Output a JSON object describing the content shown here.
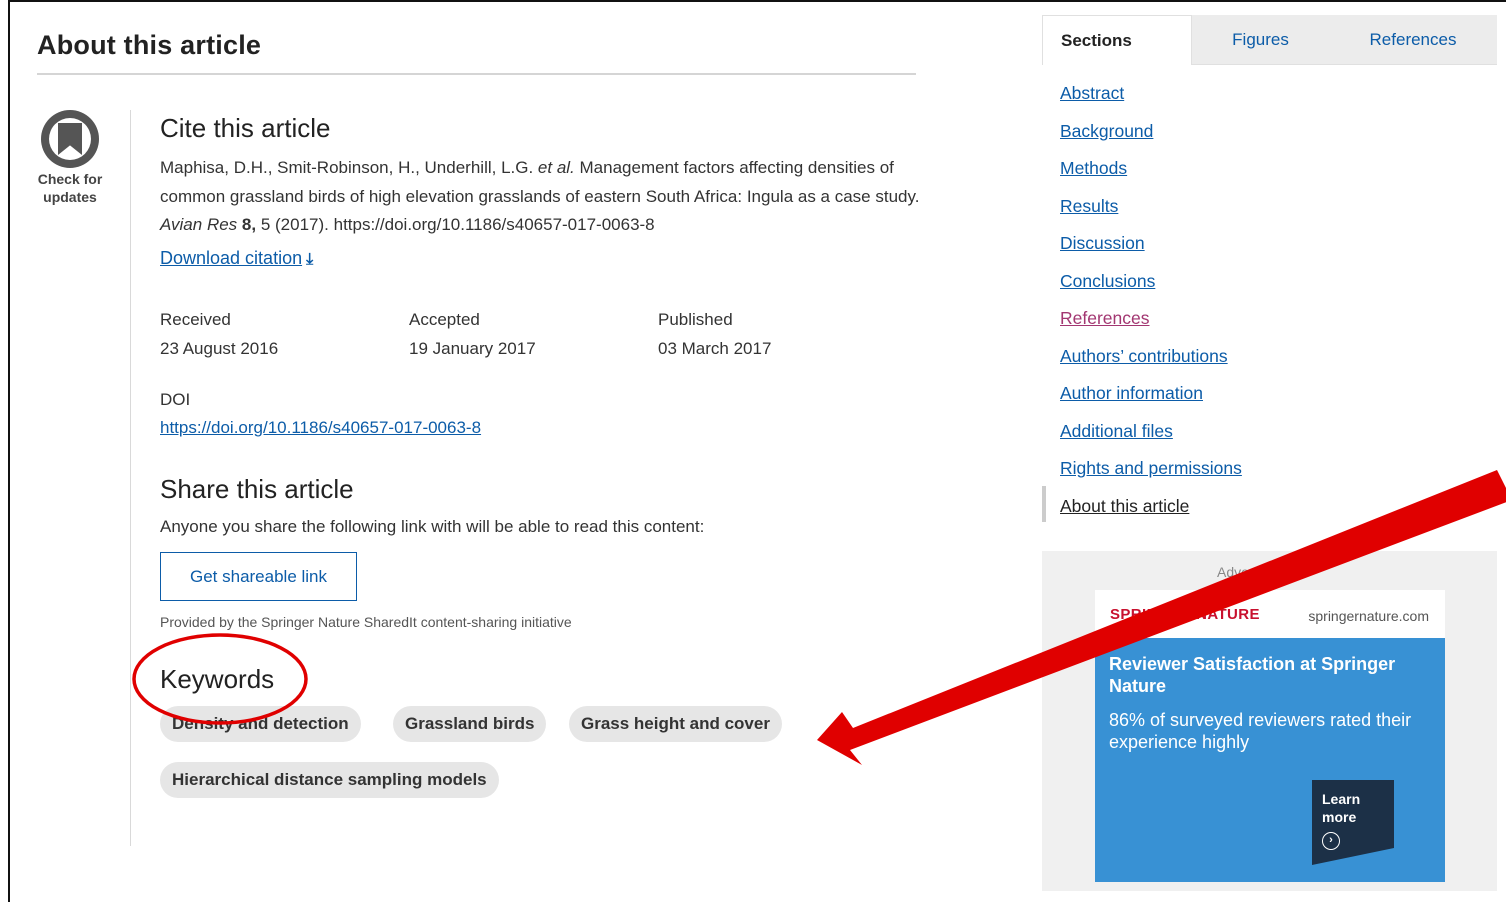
{
  "article": {
    "section_title": "About this article",
    "check_updates": "Check for updates",
    "cite_title": "Cite this article",
    "cite_authors": "Maphisa, D.H., Smit-Robinson, H., Underhill, L.G.",
    "cite_etal": "et al.",
    "cite_title_text": "Management factors affecting densities of common grassland birds of high elevation grasslands of eastern South Africa: Ingula as a case study.",
    "cite_journal": "Avian Res",
    "cite_volume": "8,",
    "cite_rest": "5 (2017). https://doi.org/10.1186/s40657-017-0063-8",
    "download_citation": "Download citation",
    "dates": [
      {
        "label": "Received",
        "value": "23 August 2016"
      },
      {
        "label": "Accepted",
        "value": "19 January 2017"
      },
      {
        "label": "Published",
        "value": "03 March 2017"
      }
    ],
    "doi_label": "DOI",
    "doi_link": "https://doi.org/10.1186/s40657-017-0063-8",
    "share_title": "Share this article",
    "share_desc": "Anyone you share the following link with will be able to read this content:",
    "share_button": "Get shareable link",
    "provided_by": "Provided by the Springer Nature SharedIt content-sharing initiative",
    "keywords_title": "Keywords",
    "keywords": [
      "Density and detection",
      "Grassland birds",
      "Grass height and cover",
      "Hierarchical distance sampling models"
    ]
  },
  "sidebar": {
    "tabs": [
      "Sections",
      "Figures",
      "References"
    ],
    "nav": [
      "Abstract",
      "Background",
      "Methods",
      "Results",
      "Discussion",
      "Conclusions",
      "References",
      "Authors’ contributions",
      "Author information",
      "Additional files",
      "Rights and permissions",
      "About this article"
    ]
  },
  "ad": {
    "label": "Advertisement",
    "brand": "SPRINGER NATURE",
    "url": "springernature.com",
    "headline": "Reviewer Satisfaction at Springer Nature",
    "subtext": "86% of surveyed reviewers rated their experience highly",
    "cta": "Learn more"
  },
  "colors": {
    "link": "#0c5ca8",
    "visited_link": "#a23671",
    "annotation": "#e00000",
    "ad_blue": "#3891d4"
  }
}
